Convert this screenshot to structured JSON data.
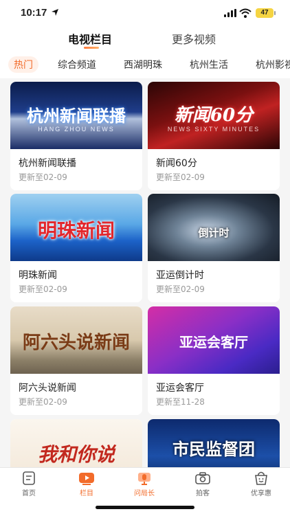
{
  "status_bar": {
    "time": "10:17",
    "battery": "47"
  },
  "header": {
    "tabs": [
      {
        "label": "电视栏目"
      },
      {
        "label": "更多视频"
      }
    ]
  },
  "categories": [
    {
      "label": "热门"
    },
    {
      "label": "综合频道"
    },
    {
      "label": "西湖明珠"
    },
    {
      "label": "杭州生活"
    },
    {
      "label": "杭州影视"
    }
  ],
  "cards": [
    {
      "title": "杭州新闻联播",
      "updated": "更新至02-09",
      "thumb_text": "杭州新闻联播",
      "thumb_sub": "HANG ZHOU NEWS"
    },
    {
      "title": "新闻60分",
      "updated": "更新至02-09",
      "thumb_text": "新闻60分",
      "thumb_sub": "NEWS SIXTY MINUTES"
    },
    {
      "title": "明珠新闻",
      "updated": "更新至02-09",
      "thumb_text": "明珠新闻"
    },
    {
      "title": "亚运倒计时",
      "updated": "更新至02-09",
      "thumb_text": "倒计时"
    },
    {
      "title": "阿六头说新闻",
      "updated": "更新至02-09",
      "thumb_text": "阿六头说新闻"
    },
    {
      "title": "亚运会客厅",
      "updated": "更新至11-28",
      "thumb_text": "亚运会客厅"
    },
    {
      "thumb_text": "我和你说"
    },
    {
      "thumb_text": "市民监督团"
    }
  ],
  "bottom_nav": [
    {
      "label": "首页"
    },
    {
      "label": "栏目"
    },
    {
      "label": "问局长"
    },
    {
      "label": "拍客"
    },
    {
      "label": "优享惠"
    }
  ],
  "colors": {
    "accent": "#f26b2a",
    "accent_light": "#fff0e8",
    "background": "#f5f5f5"
  }
}
